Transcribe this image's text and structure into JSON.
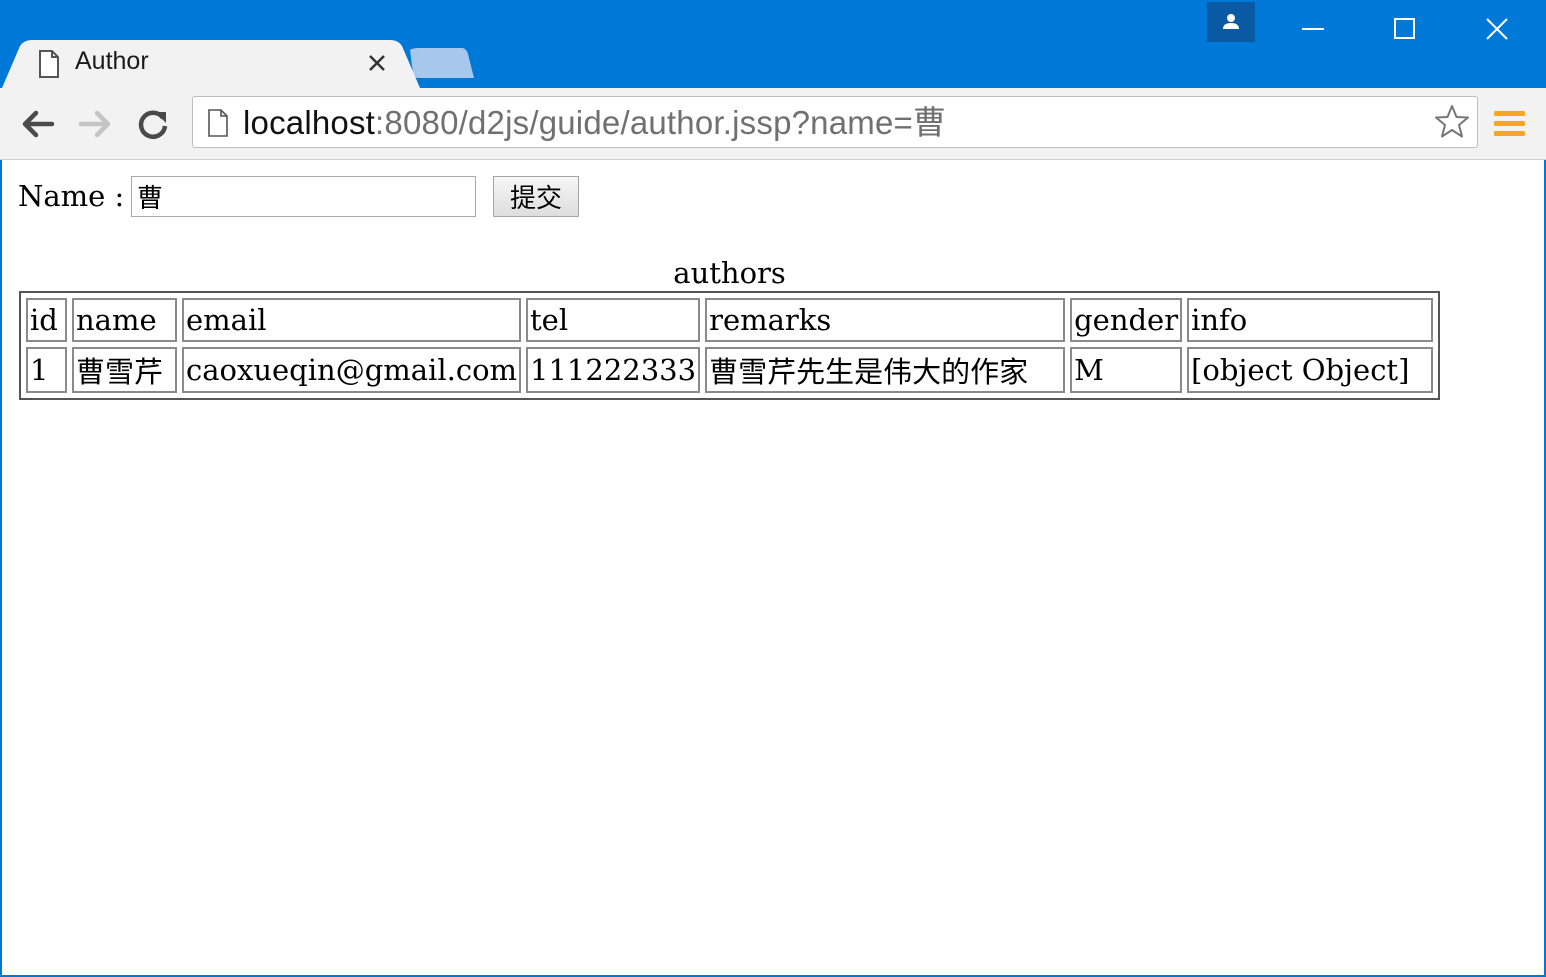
{
  "browser": {
    "tab": {
      "title": "Author"
    },
    "address": {
      "host": "localhost",
      "rest": ":8080/d2js/guide/author.jssp?name=曹"
    }
  },
  "form": {
    "label": "Name :",
    "input_value": "曹",
    "submit_label": "提交"
  },
  "table": {
    "caption": "authors",
    "headers": [
      "id",
      "name",
      "email",
      "tel",
      "remarks",
      "gender",
      "info"
    ],
    "rows": [
      [
        "1",
        "曹雪芹",
        "caoxueqin@gmail.com",
        "111222333",
        "曹雪芹先生是伟大的作家",
        "M",
        "[object Object]"
      ]
    ]
  },
  "colors": {
    "titlebar": "#0078d7",
    "menu_icon": "#f5a623"
  }
}
